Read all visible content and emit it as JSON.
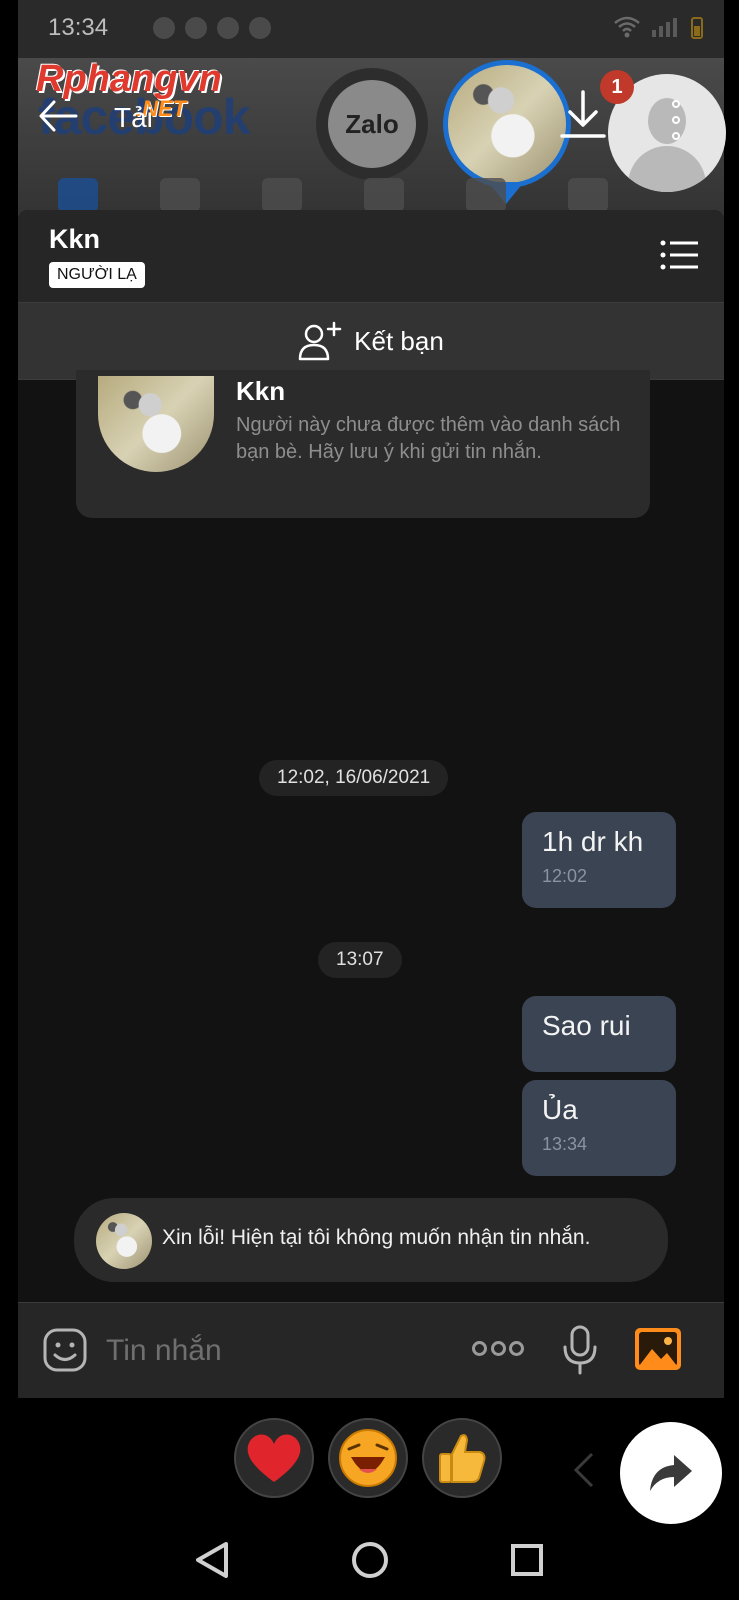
{
  "status_bar": {
    "time": "13:34"
  },
  "watermark": {
    "brand": "Rphangvn",
    "suffix": ".NET"
  },
  "overlay": {
    "back_label": "Tải",
    "fb_text": "facebook",
    "zalo_label": "Zalo",
    "notification_count": "1"
  },
  "chat_header": {
    "name": "Kkn",
    "badge": "NGƯỜI LẠ"
  },
  "add_friend": {
    "label": "Kết bạn"
  },
  "profile_card": {
    "name": "Kkn",
    "note": "Người này chưa được thêm vào danh sách bạn bè. Hãy lưu ý khi gửi tin nhắn."
  },
  "messages": {
    "divider1": "12:02, 16/06/2021",
    "msg1": {
      "text": "1h dr kh",
      "time": "12:02"
    },
    "divider2": "13:07",
    "msg2": {
      "text": "Sao rui"
    },
    "msg3": {
      "text": "Ủa",
      "time": "13:34"
    },
    "auto_reply": "Xin lỗi! Hiện tại tôi không muốn nhận tin nhắn."
  },
  "input": {
    "placeholder": "Tin nhắn"
  },
  "quick_reactions": [
    "heart",
    "laugh",
    "thumbs-up"
  ],
  "colors": {
    "bubble": "#3a4452",
    "accent": "#1a6fd0",
    "image_icon": "#ff8c1a",
    "heart": "#e0262c"
  }
}
